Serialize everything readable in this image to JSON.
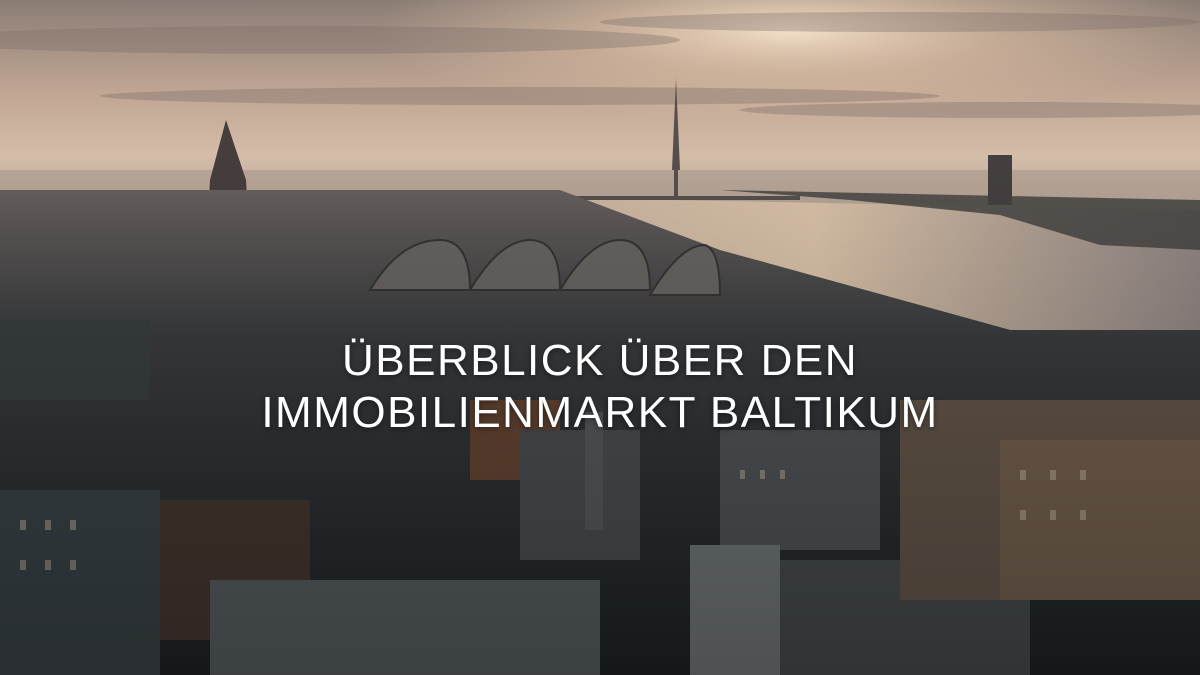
{
  "headline": {
    "line1": "ÜBERBLICK ÜBER DEN",
    "line2": "IMMOBILIENMARKT BALTIKUM"
  },
  "colors": {
    "sky_top": "#8e8078",
    "sky_glow": "#f3d9bd",
    "river": "#c9b2a0",
    "city_dark": "#2a2f33",
    "headline_text": "#ffffff"
  },
  "image": {
    "icon": "aerial-cityscape-photo"
  }
}
